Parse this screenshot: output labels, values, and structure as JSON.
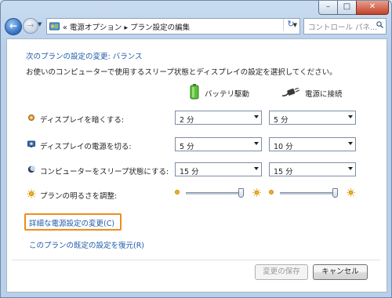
{
  "window": {
    "caption_buttons": {
      "minimize": "–",
      "maximize": "□",
      "close": "✕"
    }
  },
  "nav": {
    "back_icon": "back-arrow-icon",
    "forward_icon": "forward-arrow-icon",
    "breadcrumb_prefix": "«",
    "breadcrumb": [
      "電源オプション",
      "プラン設定の編集"
    ],
    "separator": "▸",
    "address_text": "« 電源オプション ▸ プラン設定の編集",
    "refresh_glyph": "↻",
    "search_placeholder": "コントロール パネ..."
  },
  "main": {
    "heading": "次のプランの設定の変更: バランス",
    "description": "お使いのコンピューターで使用するスリープ状態とディスプレイの設定を選択してください。",
    "columns": {
      "battery": "バッテリ駆動",
      "plugged": "電源に接続"
    },
    "rows": [
      {
        "label": "ディスプレイを暗くする:",
        "icon": "dim-display-icon",
        "battery": "2 分",
        "plugged": "5 分"
      },
      {
        "label": "ディスプレイの電源を切る:",
        "icon": "display-off-icon",
        "battery": "5 分",
        "plugged": "10 分"
      },
      {
        "label": "コンピューターをスリープ状態にする:",
        "icon": "sleep-moon-icon",
        "battery": "15 分",
        "plugged": "15 分"
      }
    ],
    "brightness": {
      "label": "プランの明るさを調整:",
      "battery_level": 1.0,
      "plugged_level": 1.0
    },
    "advanced_link": "詳細な電源設定の変更(C)",
    "restore_link": "このプランの既定の設定を復元(R)"
  },
  "buttons": {
    "save": "変更の保存",
    "cancel": "キャンセル"
  },
  "colors": {
    "link": "#1f5ba8",
    "highlight": "#f08c1c"
  }
}
